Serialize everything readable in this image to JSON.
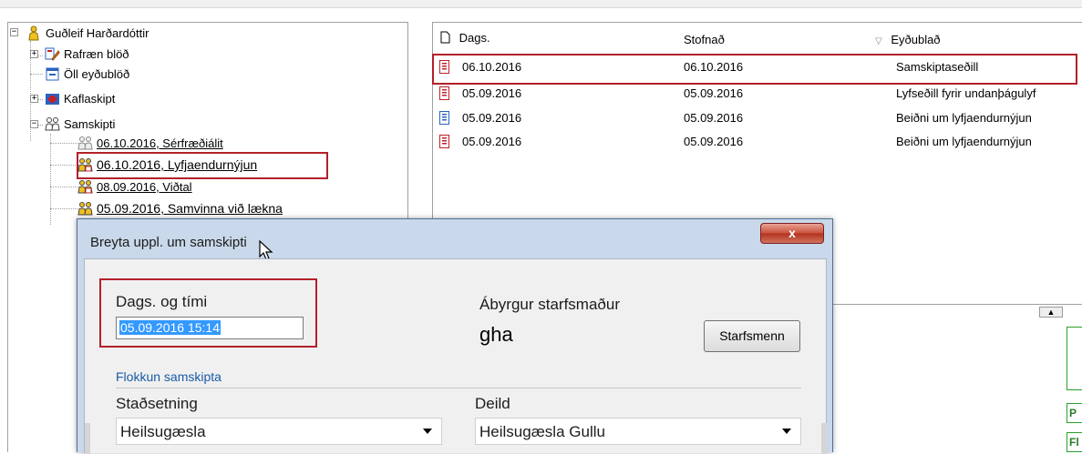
{
  "tree": {
    "root": "Guðleif Harðardóttir",
    "items": [
      {
        "label": "Rafræn blöð"
      },
      {
        "label": "Öll eyðublöð"
      },
      {
        "label": "Kaflaskipt"
      },
      {
        "label": "Samskipti"
      }
    ],
    "samskipti_children": [
      {
        "label": "06.10.2016, Sérfræðiálit"
      },
      {
        "label": "06.10.2016, Lyfjaendurnýjun"
      },
      {
        "label": "08.09.2016, Viðtal"
      },
      {
        "label": "05.09.2016, Samvinna við lækna"
      }
    ]
  },
  "list": {
    "columns": [
      "Dags.",
      "Stofnað",
      "Eyðublað"
    ],
    "rows": [
      {
        "dags": "06.10.2016",
        "stofnad": "06.10.2016",
        "eydublad": "Samskiptaseðill",
        "icon_color": "#c0202a"
      },
      {
        "dags": "05.09.2016",
        "stofnad": "05.09.2016",
        "eydublad": "Lyfseðill fyrir undanþágulyf",
        "icon_color": "#c0202a"
      },
      {
        "dags": "05.09.2016",
        "stofnad": "05.09.2016",
        "eydublad": "Beiðni um lyfjaendurnýjun",
        "icon_color": "#2a62c0"
      },
      {
        "dags": "05.09.2016",
        "stofnad": "05.09.2016",
        "eydublad": "Beiðni um lyfjaendurnýjun",
        "icon_color": "#c0202a"
      }
    ],
    "side_labels": [
      "P",
      "Fl"
    ]
  },
  "dialog": {
    "title": "Breyta uppl. um samskipti",
    "close_label": "x",
    "date_label": "Dags. og tími",
    "date_value": "05.09.2016 15:14",
    "staff_label": "Ábyrgur starfsmaður",
    "staff_value": "gha",
    "staff_button": "Starfsmenn",
    "group_label": "Flokkun samskipta",
    "location_label": "Staðsetning",
    "location_value": "Heilsugæsla",
    "department_label": "Deild",
    "department_value": "Heilsugæsla Gullu"
  },
  "colors": {
    "highlight": "#b3202a",
    "dialog_frame": "#c9d8ea",
    "selection": "#3399ff"
  }
}
